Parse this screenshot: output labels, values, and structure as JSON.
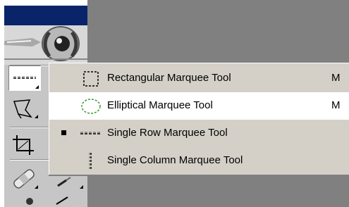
{
  "flyout": {
    "items": [
      {
        "label": "Rectangular Marquee Tool",
        "shortcut": "M",
        "icon": "rectangular-marquee-icon",
        "selected": false,
        "current": false
      },
      {
        "label": "Elliptical Marquee Tool",
        "shortcut": "M",
        "icon": "elliptical-marquee-icon",
        "selected": true,
        "current": false
      },
      {
        "label": "Single Row Marquee Tool",
        "shortcut": "",
        "icon": "single-row-marquee-icon",
        "selected": false,
        "current": true
      },
      {
        "label": "Single Column Marquee Tool",
        "shortcut": "",
        "icon": "single-column-marquee-icon",
        "selected": false,
        "current": false
      }
    ]
  },
  "toolbox": {
    "tools": [
      {
        "icon": "single-row-marquee-icon",
        "active": true
      },
      {
        "icon": "polygonal-lasso-icon",
        "active": false
      },
      {
        "icon": "crop-icon",
        "active": false
      },
      {
        "icon": "healing-brush-icon",
        "active": false
      }
    ]
  },
  "colors": {
    "title_bar": "#0a246a",
    "toolbox_bg": "#c6c6c6",
    "workspace_bg": "#808080",
    "menu_bg": "#d4d0c8",
    "menu_highlight": "#ffffff",
    "ellipse_icon": "#3d9a3d"
  }
}
